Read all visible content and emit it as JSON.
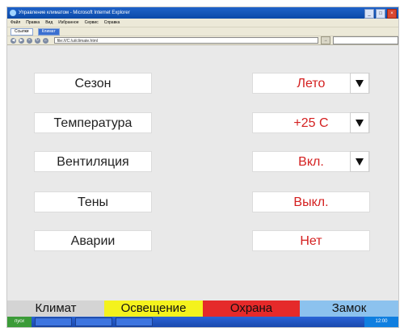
{
  "browser": {
    "title": "Управление климатом - Microsoft Internet Explorer",
    "menu": [
      "Файл",
      "Правка",
      "Вид",
      "Избранное",
      "Сервис",
      "Справка"
    ],
    "links": [
      "Ссылки",
      "Климат"
    ],
    "address": "file:///C:/ui/climate.html",
    "controls": [
      "_",
      "□",
      "×"
    ]
  },
  "rows": [
    {
      "label": "Сезон",
      "value": "Лето",
      "has_dropdown": true
    },
    {
      "label": "Температура",
      "value": "+25 С",
      "has_dropdown": true
    },
    {
      "label": "Вентиляция",
      "value": "Вкл.",
      "has_dropdown": true
    },
    {
      "label": "Тены",
      "value": "Выкл.",
      "has_dropdown": false
    },
    {
      "label": "Аварии",
      "value": "Нет",
      "has_dropdown": false
    }
  ],
  "tabs": {
    "climate": "Климат",
    "lighting": "Освещение",
    "security": "Охрана",
    "lock": "Замок"
  },
  "taskbar": {
    "start": "пуск",
    "clock": "12:00"
  },
  "colors": {
    "value_text": "#d42020",
    "tab_climate": "#d4d4d4",
    "tab_lighting": "#f4f21d",
    "tab_security": "#e52a2a",
    "tab_lock": "#8cc2ee"
  },
  "icons": {
    "dropdown": "triangle-down",
    "browser": "ie-logo"
  }
}
